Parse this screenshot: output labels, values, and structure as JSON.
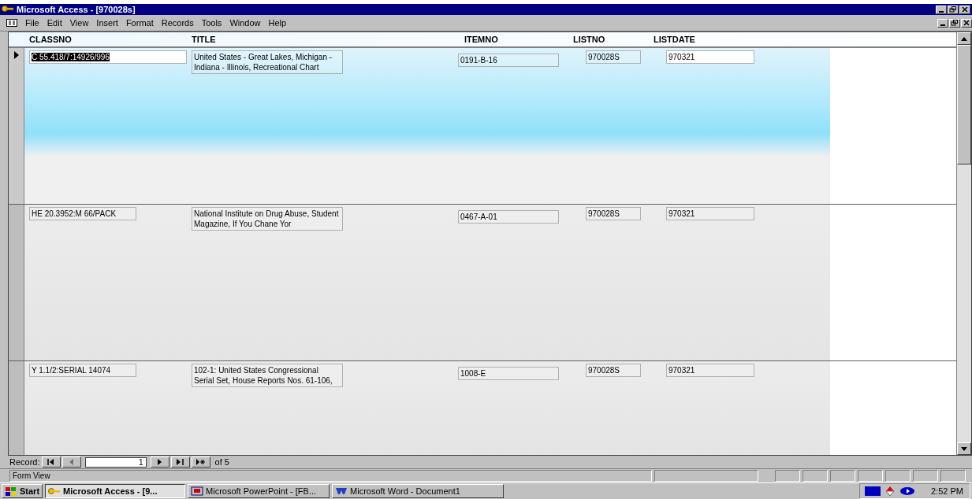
{
  "window": {
    "title": "Microsoft Access - [970028s]"
  },
  "menu": [
    "File",
    "Edit",
    "View",
    "Insert",
    "Format",
    "Records",
    "Tools",
    "Window",
    "Help"
  ],
  "columns": [
    "CLASSNO",
    "TITLE",
    "ITEMNO",
    "LISTNO",
    "LISTDATE"
  ],
  "records": [
    {
      "current": true,
      "sky": true,
      "classno": "C 55.418/7:14926/996",
      "classno_highlighted": true,
      "title": "United States - Great Lakes, Michigan - Indiana - Illinois, Recreational Chart",
      "itemno": "0191-B-16",
      "listno": "970028S",
      "listdate": "970321"
    },
    {
      "current": false,
      "sky": false,
      "classno": "HE 20.3952:M 66/PACK",
      "classno_highlighted": false,
      "title": "National Institute on Drug Abuse, Student Magazine, If You Chane Yor",
      "itemno": "0467-A-01",
      "listno": "970028S",
      "listdate": "970321"
    },
    {
      "current": false,
      "sky": false,
      "classno": "Y 1.1/2:SERIAL 14074",
      "classno_highlighted": false,
      "title": "102-1: United States Congressional Serial Set, House Reports Nos. 61-106,",
      "itemno": "1008-E",
      "listno": "970028S",
      "listdate": "970321"
    }
  ],
  "navigator": {
    "label": "Record:",
    "value": "1",
    "of": "of 5",
    "buttons": [
      {
        "kind": "first",
        "disabled": false
      },
      {
        "kind": "prev",
        "disabled": true
      },
      {
        "kind": "next",
        "disabled": false
      },
      {
        "kind": "last",
        "disabled": false
      },
      {
        "kind": "new",
        "disabled": false
      }
    ]
  },
  "status_bar": {
    "text": "Form View"
  },
  "taskbar": {
    "start": "Start",
    "tasks": [
      {
        "label": "Microsoft Access - [9...",
        "kind": "access",
        "selected": true
      },
      {
        "label": "Microsoft PowerPoint - [FB...",
        "kind": "powerpoint",
        "selected": false
      },
      {
        "label": "Microsoft Word - Document1",
        "kind": "word",
        "selected": false
      }
    ],
    "time": "2:52 PM"
  }
}
